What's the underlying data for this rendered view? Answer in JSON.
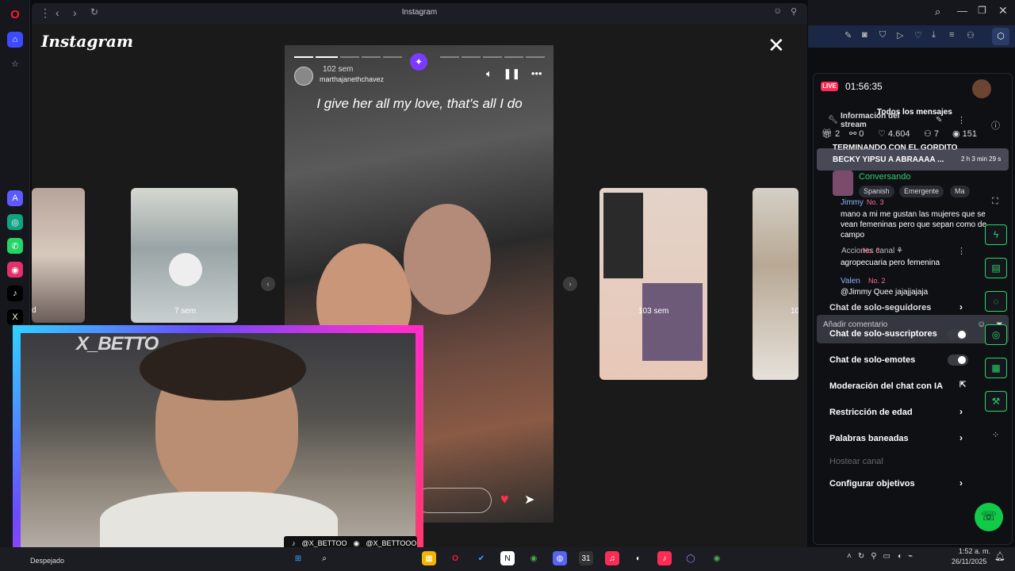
{
  "browser": {
    "tab_title": "Instagram"
  },
  "instagram": {
    "logo": "Instagram",
    "story": {
      "time_ago": "102 sem",
      "username": "marthajanethchavez",
      "caption": "I give her all my love, that's all I do"
    },
    "thumbnails": [
      {
        "label": "d"
      },
      {
        "label": "7 sem"
      },
      {
        "label": "103 sem"
      },
      {
        "label": "10"
      }
    ]
  },
  "webcam": {
    "logo": "X_BETTO",
    "tiktok_handle": "@X_BETTOO",
    "instagram_handle": "@X_BETTOOO"
  },
  "live": {
    "badge": "LIVE",
    "timer": "01:56:35",
    "info_title": "Información del stream",
    "chat_filter": "Todos los mensajes",
    "stats": {
      "gifts": "2",
      "shares": "0",
      "likes": "4.604",
      "viewers_joined": "7",
      "views": "151"
    },
    "pinned": "TERMINANDO CON EL GORDITO",
    "pinned_overlay": "BECKY YIPSU A ABRAAAA ...",
    "pinned_time": "2 h 3 min 29 s",
    "topic": "Conversando",
    "chips": [
      "Spanish",
      "Emergente",
      "Ma"
    ],
    "chat": [
      {
        "name": "Jimmy",
        "rank": "No. 3",
        "message": "mano a mi me gustan las mujeres que se vean femeninas pero que sepan como de campo"
      },
      {
        "name": "Jimmy",
        "rank": "No. 3",
        "message": "agropecuaria pero femenina"
      },
      {
        "name": "Valen",
        "rank": "No. 2",
        "message": "@Jimmy Quee jajajjajaja"
      }
    ],
    "add_comment_placeholder": "Añadir comentario",
    "menu": [
      {
        "label": "Chat de solo-seguidores",
        "control": "chevron"
      },
      {
        "label": "Chat de solo-suscriptores",
        "control": "toggle"
      },
      {
        "label": "Chat de solo-emotes",
        "control": "toggle"
      },
      {
        "label": "Moderación del chat con IA",
        "control": "external"
      },
      {
        "label": "Restricción de edad",
        "control": "chevron"
      },
      {
        "label": "Palabras baneadas",
        "control": "chevron"
      },
      {
        "label": "Hostear canal",
        "control": "none"
      },
      {
        "label": "Configurar objetivos",
        "control": "chevron"
      }
    ]
  },
  "taskbar": {
    "weather": "Despejado",
    "time": "1:52 a. m.",
    "date": "26/11/2025"
  },
  "colors": {
    "live_red": "#ff2a55",
    "tool_green": "#2bd46a",
    "heart": "#ff3040"
  }
}
